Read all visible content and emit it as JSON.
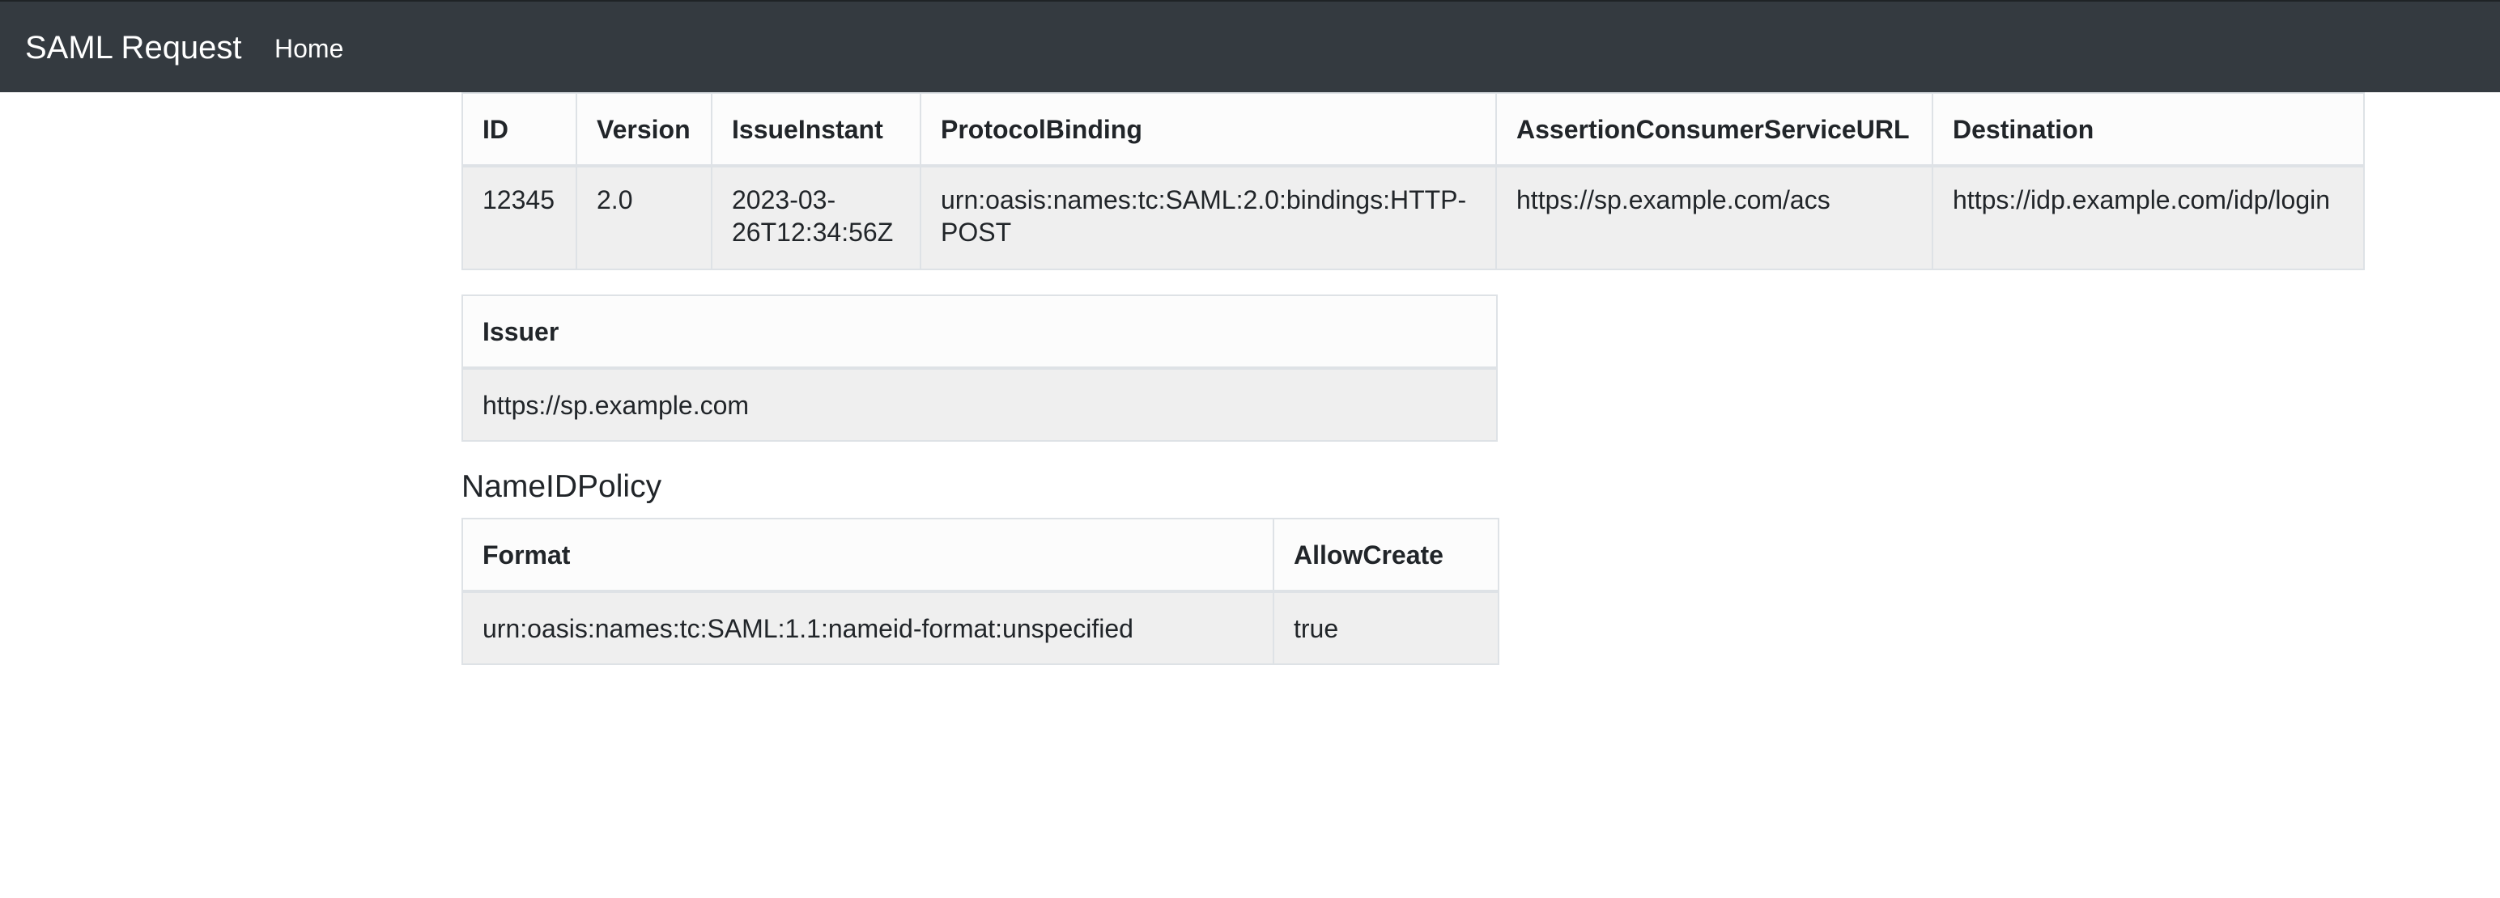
{
  "navbar": {
    "brand": "SAML Request",
    "links": [
      {
        "label": "Home"
      }
    ]
  },
  "request_table": {
    "headers": [
      "ID",
      "Version",
      "IssueInstant",
      "ProtocolBinding",
      "AssertionConsumerServiceURL",
      "Destination"
    ],
    "row": [
      "12345",
      "2.0",
      "2023-03-26T12:34:56Z",
      "urn:oasis:names:tc:SAML:2.0:bindings:HTTP-POST",
      "https://sp.example.com/acs",
      "https://idp.example.com/idp/login"
    ]
  },
  "issuer_table": {
    "headers": [
      "Issuer"
    ],
    "row": [
      "https://sp.example.com"
    ]
  },
  "nameid_policy": {
    "title": "NameIDPolicy",
    "headers": [
      "Format",
      "AllowCreate"
    ],
    "row": [
      "urn:oasis:names:tc:SAML:1.1:nameid-format:unspecified",
      "true"
    ]
  }
}
